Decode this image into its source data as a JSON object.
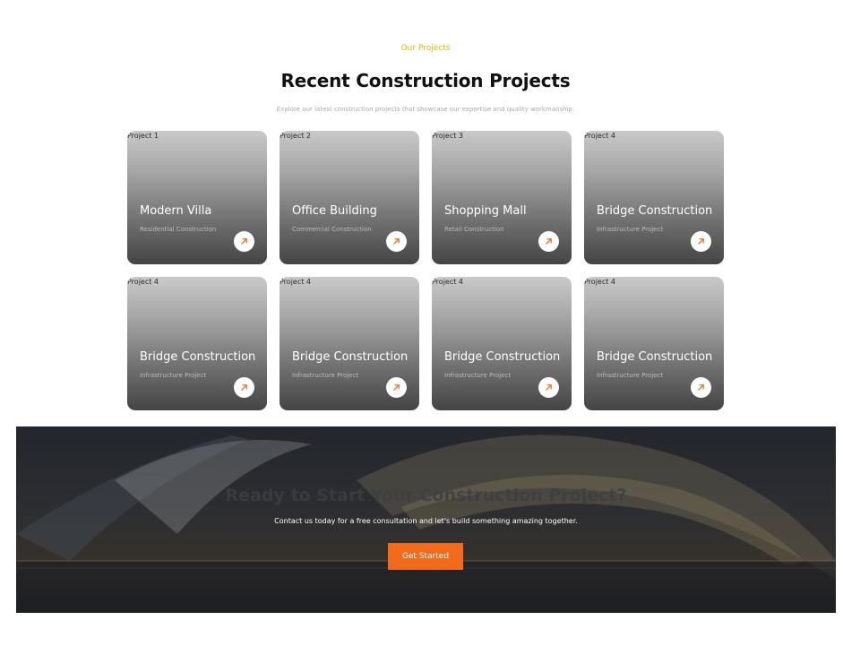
{
  "projects_section": {
    "eyebrow": "Our Projects",
    "title": "Recent Construction Projects",
    "subtitle": "Explore our latest construction projects that showcase our expertise and quality workmanship."
  },
  "projects": [
    {
      "tag": "Project 1",
      "title": "Modern Villa",
      "type": "Residential Construction",
      "arrow_icon": "arrow-up-right-icon"
    },
    {
      "tag": "Project 2",
      "title": "Office Building",
      "type": "Commercial Construction",
      "arrow_icon": "arrow-up-right-icon"
    },
    {
      "tag": "Project 3",
      "title": "Shopping Mall",
      "type": "Retail Construction",
      "arrow_icon": "arrow-up-right-icon"
    },
    {
      "tag": "Project 4",
      "title": "Bridge Construction",
      "type": "Infrastructure Project",
      "arrow_icon": "arrow-up-right-icon"
    },
    {
      "tag": "Project 4",
      "title": "Bridge Construction",
      "type": "Infrastructure Project",
      "arrow_icon": "arrow-up-right-icon"
    },
    {
      "tag": "Project 4",
      "title": "Bridge Construction",
      "type": "Infrastructure Project",
      "arrow_icon": "arrow-up-right-icon"
    },
    {
      "tag": "Project 4",
      "title": "Bridge Construction",
      "type": "Infrastructure Project",
      "arrow_icon": "arrow-up-right-icon"
    },
    {
      "tag": "Project 4",
      "title": "Bridge Construction",
      "type": "Infrastructure Project",
      "arrow_icon": "arrow-up-right-icon"
    }
  ],
  "cta": {
    "title": "Ready to Start Your Construction Project?",
    "subtitle": "Contact us today for a free consultation and let's build something amazing together.",
    "button_label": "Get Started"
  },
  "colors": {
    "accent_yellow": "#f0b400",
    "accent_orange": "#f26a1b"
  }
}
